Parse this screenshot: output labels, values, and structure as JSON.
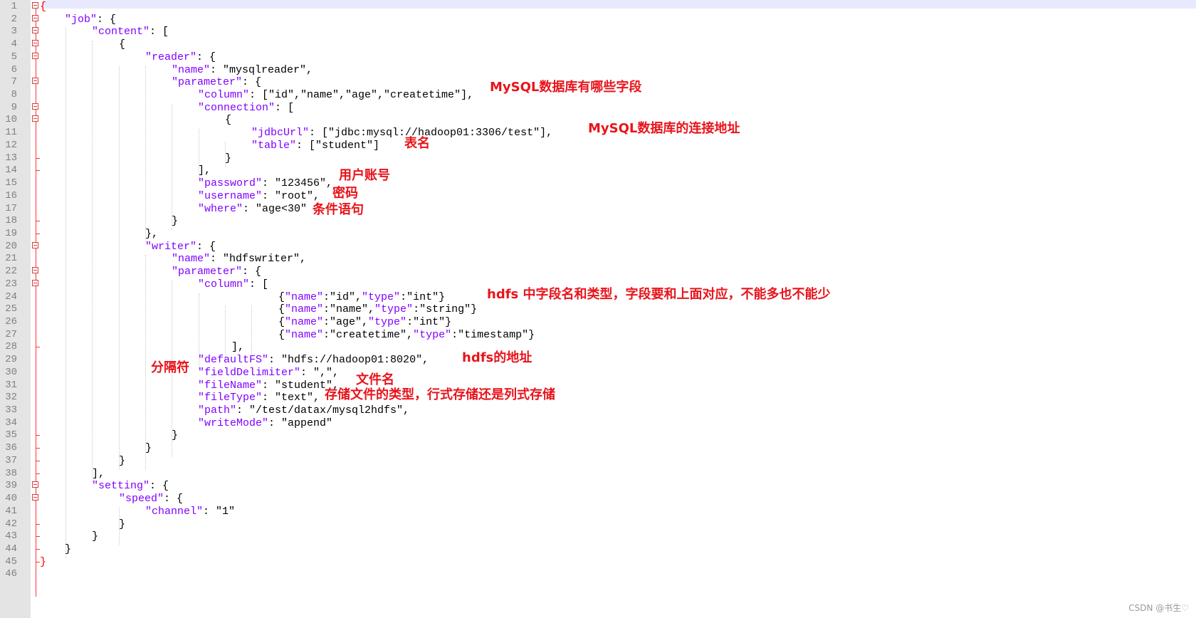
{
  "lines": [
    [
      [
        "{",
        "r"
      ]
    ],
    [
      [
        "\"job\"",
        "k"
      ],
      [
        ": {",
        "p"
      ]
    ],
    [
      [
        "\"content\"",
        "k"
      ],
      [
        ": [",
        "p"
      ]
    ],
    [
      [
        "{",
        "p"
      ]
    ],
    [
      [
        "\"reader\"",
        "k"
      ],
      [
        ": {",
        "p"
      ]
    ],
    [
      [
        "\"name\"",
        "k"
      ],
      [
        ": \"mysqlreader\",",
        "v"
      ]
    ],
    [
      [
        "\"parameter\"",
        "k"
      ],
      [
        ": {",
        "p"
      ]
    ],
    [
      [
        "\"column\"",
        "k"
      ],
      [
        ": [\"id\",\"name\",\"age\",\"createtime\"],",
        "v"
      ]
    ],
    [
      [
        "\"connection\"",
        "k"
      ],
      [
        ": [",
        "p"
      ]
    ],
    [
      [
        "{",
        "p"
      ]
    ],
    [
      [
        "\"jdbcUrl\"",
        "k"
      ],
      [
        ": [\"jdbc:mysql://hadoop01:3306/test\"],",
        "v"
      ]
    ],
    [
      [
        "\"table\"",
        "k"
      ],
      [
        ": [\"student\"]",
        "v"
      ]
    ],
    [
      [
        "}",
        "p"
      ]
    ],
    [
      [
        "],",
        "p"
      ]
    ],
    [
      [
        "\"password\"",
        "k"
      ],
      [
        ": \"123456\",",
        "v"
      ]
    ],
    [
      [
        "\"username\"",
        "k"
      ],
      [
        ": \"root\",",
        "v"
      ]
    ],
    [
      [
        "\"where\"",
        "k"
      ],
      [
        ": \"age<30\"",
        "v"
      ]
    ],
    [
      [
        "}",
        "p"
      ]
    ],
    [
      [
        "},",
        "p"
      ]
    ],
    [
      [
        "\"writer\"",
        "k"
      ],
      [
        ": {",
        "p"
      ]
    ],
    [
      [
        "\"name\"",
        "k"
      ],
      [
        ": \"hdfswriter\",",
        "v"
      ]
    ],
    [
      [
        "\"parameter\"",
        "k"
      ],
      [
        ": {",
        "p"
      ]
    ],
    [
      [
        "\"column\"",
        "k"
      ],
      [
        ": [",
        "p"
      ]
    ],
    [
      [
        "{",
        "p"
      ],
      [
        "\"name\"",
        "k"
      ],
      [
        ":\"id\",",
        "v"
      ],
      [
        "\"type\"",
        "k"
      ],
      [
        ":\"int\"}",
        "v"
      ]
    ],
    [
      [
        "{",
        "p"
      ],
      [
        "\"name\"",
        "k"
      ],
      [
        ":\"name\",",
        "v"
      ],
      [
        "\"type\"",
        "k"
      ],
      [
        ":\"string\"}",
        "v"
      ]
    ],
    [
      [
        "{",
        "p"
      ],
      [
        "\"name\"",
        "k"
      ],
      [
        ":\"age\",",
        "v"
      ],
      [
        "\"type\"",
        "k"
      ],
      [
        ":\"int\"}",
        "v"
      ]
    ],
    [
      [
        "{",
        "p"
      ],
      [
        "\"name\"",
        "k"
      ],
      [
        ":\"createtime\",",
        "v"
      ],
      [
        "\"type\"",
        "k"
      ],
      [
        ":\"timestamp\"}",
        "v"
      ]
    ],
    [
      [
        "],",
        "p"
      ]
    ],
    [
      [
        "\"defaultFS\"",
        "k"
      ],
      [
        ": \"hdfs://hadoop01:8020\",",
        "v"
      ]
    ],
    [
      [
        "\"fieldDelimiter\"",
        "k"
      ],
      [
        ": \",\",",
        "v"
      ]
    ],
    [
      [
        "\"fileName\"",
        "k"
      ],
      [
        ": \"student\",",
        "v"
      ]
    ],
    [
      [
        "\"fileType\"",
        "k"
      ],
      [
        ": \"text\",",
        "v"
      ]
    ],
    [
      [
        "\"path\"",
        "k"
      ],
      [
        ": \"/test/datax/mysql2hdfs\",",
        "v"
      ]
    ],
    [
      [
        "\"writeMode\"",
        "k"
      ],
      [
        ": \"append\"",
        "v"
      ]
    ],
    [
      [
        "}",
        "p"
      ]
    ],
    [
      [
        "}",
        "p"
      ]
    ],
    [
      [
        "}",
        "p"
      ]
    ],
    [
      [
        "],",
        "p"
      ]
    ],
    [
      [
        "\"setting\"",
        "k"
      ],
      [
        ": {",
        "p"
      ]
    ],
    [
      [
        "\"speed\"",
        "k"
      ],
      [
        ": {",
        "p"
      ]
    ],
    [
      [
        "\"channel\"",
        "k"
      ],
      [
        ": \"1\"",
        "v"
      ]
    ],
    [
      [
        "}",
        "p"
      ]
    ],
    [
      [
        "}",
        "p"
      ]
    ],
    [
      [
        "}",
        "p"
      ]
    ],
    [
      [
        "}",
        "r"
      ]
    ],
    []
  ],
  "annotations": [
    "MySQL数据库有哪些字段",
    "MySQL数据库的连接地址",
    "表名",
    "用户账号",
    "密码",
    "条件语句",
    "hdfs 中字段名和类型，字段要和上面对应，不能多也不能少",
    "hdfs的地址",
    "分隔符",
    "文件名",
    "存储文件的类型，行式存储还是列式存储"
  ],
  "watermark": "CSDN @书生♡",
  "colors": {
    "key": "#8000ff",
    "annotation": "#e8141b",
    "fold_marker": "#ff0000",
    "gutter": "#e4e4e4"
  }
}
